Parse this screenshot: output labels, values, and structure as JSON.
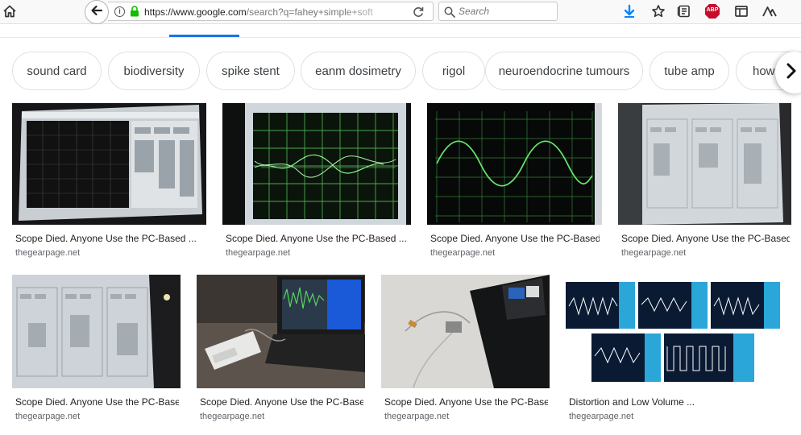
{
  "browser": {
    "url_domain": "https://www.google.com",
    "url_rest": "/search?q=fahey+simple+soft",
    "search_placeholder": "Search",
    "abp_label": "ABP"
  },
  "chips": [
    {
      "label": "sound card"
    },
    {
      "label": "biodiversity"
    },
    {
      "label": "spike stent"
    },
    {
      "label": "eanm dosimetry"
    },
    {
      "label": "rigol"
    },
    {
      "label": "neuroendocrine tumours"
    },
    {
      "label": "tube amp"
    },
    {
      "label": "howa"
    }
  ],
  "results": [
    {
      "title": "Scope Died. Anyone Use the PC-Based ...",
      "site": "thegearpage.net"
    },
    {
      "title": "Scope Died. Anyone Use the PC-Based ...",
      "site": "thegearpage.net"
    },
    {
      "title": "Scope Died. Anyone Use the PC-Based ...",
      "site": "thegearpage.net"
    },
    {
      "title": "Scope Died. Anyone Use the PC-Based ...",
      "site": "thegearpage.net"
    },
    {
      "title": "Scope Died. Anyone Use the PC-Based ...",
      "site": "thegearpage.net"
    },
    {
      "title": "Scope Died. Anyone Use the PC-Based ...",
      "site": "thegearpage.net"
    },
    {
      "title": "Scope Died. Anyone Use the PC-Based ...",
      "site": "thegearpage.net"
    },
    {
      "title": "Distortion and Low Volume ...",
      "site": "thegearpage.net"
    }
  ],
  "colors": {
    "accent": "#1a73e8",
    "download_arrow": "#0a84ff",
    "abp_red": "#c70d2c",
    "scope_green": "#4fd25a"
  },
  "icons": [
    "home-icon",
    "back-arrow-icon",
    "info-icon",
    "lock-icon",
    "reload-icon",
    "search-icon",
    "download-icon",
    "bookmark-star-icon",
    "reader-icon",
    "abp-icon",
    "sidebar-icon",
    "extension-icon",
    "chevron-right-icon"
  ]
}
